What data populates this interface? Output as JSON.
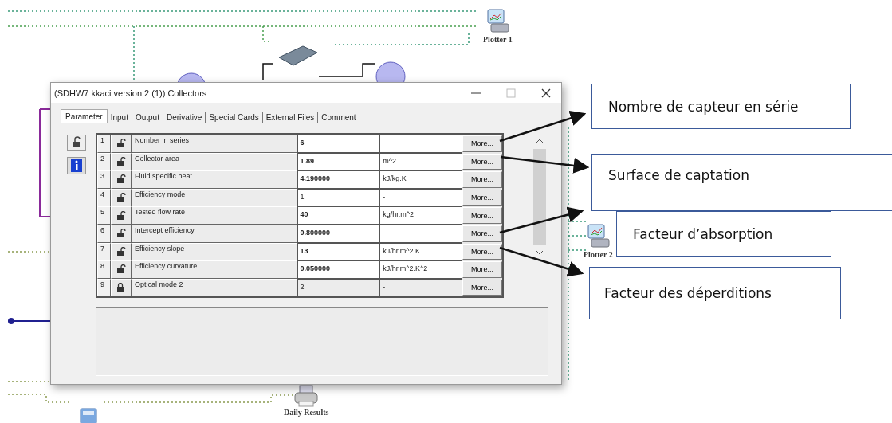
{
  "canvas": {
    "components": [
      {
        "label": "Plotter 1",
        "kind": "plotter"
      },
      {
        "label": "Plotter 2",
        "kind": "plotter"
      },
      {
        "label": "Daily Results",
        "kind": "printer"
      }
    ]
  },
  "dialog": {
    "title": "(SDHW7 kkaci version 2 (1)) Collectors",
    "tabs": [
      {
        "label": "Parameter",
        "selected": true
      },
      {
        "label": "Input",
        "selected": false
      },
      {
        "label": "Output",
        "selected": false
      },
      {
        "label": "Derivative",
        "selected": false
      },
      {
        "label": "Special Cards",
        "selected": false
      },
      {
        "label": "External Files",
        "selected": false
      },
      {
        "label": "Comment",
        "selected": false
      }
    ],
    "parameters": [
      {
        "index": "1",
        "locked": false,
        "modified": true,
        "name": "Number in series",
        "value": "6",
        "unit": "-",
        "button": "More..."
      },
      {
        "index": "2",
        "locked": false,
        "modified": true,
        "name": "Collector area",
        "value": "1.89",
        "unit": "m^2",
        "button": "More..."
      },
      {
        "index": "3",
        "locked": false,
        "modified": true,
        "name": "Fluid specific heat",
        "value": "4.190000",
        "unit": "kJ/kg.K",
        "button": "More..."
      },
      {
        "index": "4",
        "locked": false,
        "modified": false,
        "name": "Efficiency mode",
        "value": "1",
        "unit": "-",
        "button": "More..."
      },
      {
        "index": "5",
        "locked": false,
        "modified": true,
        "name": "Tested flow rate",
        "value": "40",
        "unit": "kg/hr.m^2",
        "button": "More..."
      },
      {
        "index": "6",
        "locked": false,
        "modified": true,
        "name": "Intercept efficiency",
        "value": "0.800000",
        "unit": "-",
        "button": "More..."
      },
      {
        "index": "7",
        "locked": false,
        "modified": true,
        "name": "Efficiency slope",
        "value": "13",
        "unit": "kJ/hr.m^2.K",
        "button": "More..."
      },
      {
        "index": "8",
        "locked": false,
        "modified": true,
        "name": "Efficiency curvature",
        "value": "0.050000",
        "unit": "kJ/hr.m^2.K^2",
        "button": "More..."
      },
      {
        "index": "9",
        "locked": true,
        "modified": false,
        "name": "Optical mode 2",
        "value": "2",
        "unit": "-",
        "button": "More..."
      }
    ]
  },
  "callouts": [
    {
      "text": "Nombre de capteur en série"
    },
    {
      "text": "Surface de captation"
    },
    {
      "text": "Facteur d’absorption"
    },
    {
      "text": "Facteur des déperditions"
    }
  ]
}
